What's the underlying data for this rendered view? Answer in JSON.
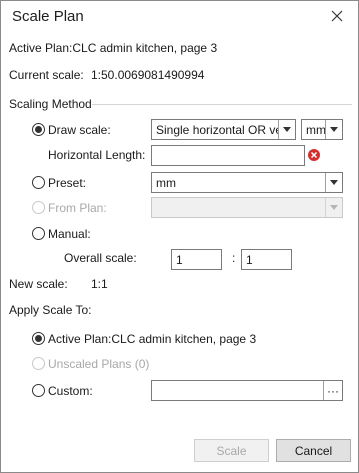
{
  "window": {
    "title": "Scale Plan"
  },
  "header": {
    "active_plan": "Active Plan:CLC admin kitchen, page 3",
    "current_scale_label": "Current scale:",
    "current_scale_value": "1:50.0069081490994"
  },
  "scaling_method": {
    "heading": "Scaling Method",
    "draw_scale": {
      "label": "Draw scale:",
      "checked": true,
      "mode_value": "Single horizontal OR verti",
      "unit_value": "mm",
      "length_label": "Horizontal Length:",
      "length_value": ""
    },
    "preset": {
      "label": "Preset:",
      "checked": false,
      "value": "mm"
    },
    "from_plan": {
      "label": "From Plan:",
      "checked": false,
      "disabled": true,
      "value": ""
    },
    "manual": {
      "label": "Manual:",
      "checked": false,
      "overall_label": "Overall scale:",
      "left_value": "1",
      "separator": ":",
      "right_value": "1"
    },
    "new_scale_label": "New scale:",
    "new_scale_value": "1:1"
  },
  "apply_to": {
    "heading": "Apply Scale To:",
    "active_plan": {
      "label": "Active Plan:CLC admin kitchen, page 3",
      "checked": true
    },
    "unscaled": {
      "label": "Unscaled Plans (0)",
      "checked": false,
      "disabled": true
    },
    "custom": {
      "label": "Custom:",
      "checked": false,
      "value": "",
      "browse_label": "···"
    }
  },
  "buttons": {
    "scale": "Scale",
    "cancel": "Cancel"
  },
  "colors": {
    "error_icon": "#d32f2f",
    "border": "#7a7a7a",
    "disabled_text": "#a8a8a8"
  }
}
